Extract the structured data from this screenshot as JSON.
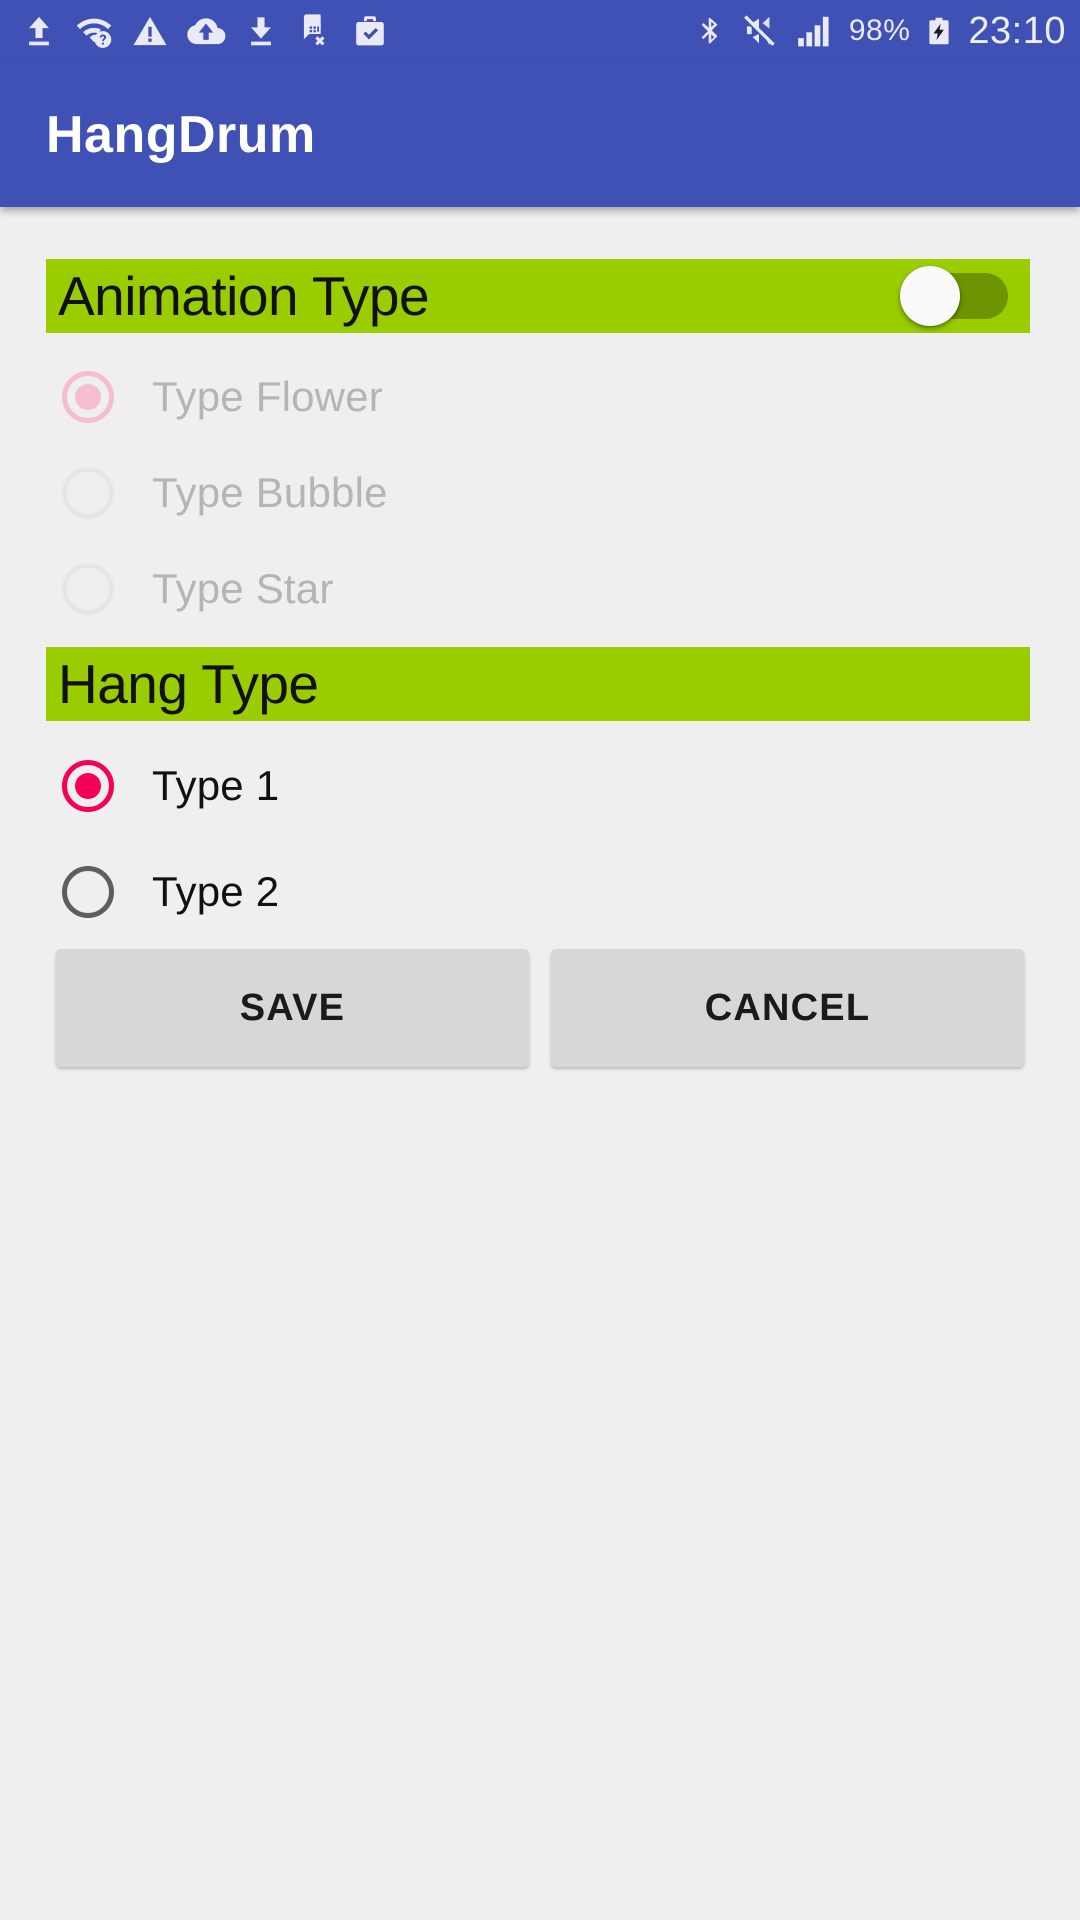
{
  "status_bar": {
    "background": "#3F51B5",
    "left_icons": [
      {
        "name": "upload-icon",
        "label": "upload"
      },
      {
        "name": "wifi-question-icon",
        "label": "wifi unknown"
      },
      {
        "name": "warning-triangle-icon",
        "label": "warning"
      },
      {
        "name": "cloud-upload-icon",
        "label": "cloud upload"
      },
      {
        "name": "download-icon",
        "label": "download"
      },
      {
        "name": "sim-card-error-icon",
        "label": "sim card error"
      },
      {
        "name": "work-briefcase-check-icon",
        "label": "work profile"
      }
    ],
    "right_icons": [
      {
        "name": "bluetooth-icon",
        "label": "bluetooth"
      },
      {
        "name": "volume-muted-icon",
        "label": "silent"
      },
      {
        "name": "signal-bars-icon",
        "label": "cellular signal"
      }
    ],
    "battery_percent": "98%",
    "battery_icon": "battery-charging-icon",
    "clock": "23:10"
  },
  "app_bar": {
    "title": "HangDrum"
  },
  "theme": {
    "primary": "#3F51B5",
    "section_green": "#9ACD00",
    "accent_pink": "#F50057",
    "accent_pink_disabled": "#F6BDD2",
    "page_background": "#EFEFEF",
    "switch_track": "#6E9400",
    "switch_thumb": "#FAFAFA",
    "button_background": "#D6D7D9"
  },
  "sections": [
    {
      "id": "animation-type",
      "header": "Animation Type",
      "has_switch": true,
      "switch_state": "off",
      "enabled": false,
      "options": [
        {
          "label": "Type Flower",
          "checked": true
        },
        {
          "label": "Type Bubble",
          "checked": false
        },
        {
          "label": "Type Star",
          "checked": false
        }
      ]
    },
    {
      "id": "hang-type",
      "header": "Hang Type",
      "has_switch": false,
      "enabled": true,
      "options": [
        {
          "label": "Type 1",
          "checked": true
        },
        {
          "label": "Type 2",
          "checked": false
        }
      ]
    }
  ],
  "buttons": {
    "save_label": "SAVE",
    "cancel_label": "CANCEL"
  }
}
